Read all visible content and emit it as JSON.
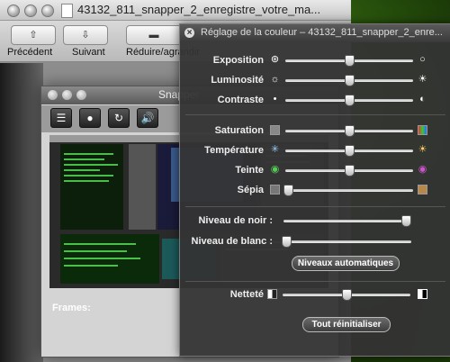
{
  "preview": {
    "title": "43132_811_snapper_2_enregistre_votre_ma...",
    "toolbar": {
      "prev_label": "Précédent",
      "next_label": "Suivant",
      "zoom_label": "Réduire/agrandir"
    }
  },
  "snapper": {
    "title": "Snapper",
    "frames_label": "Frames:"
  },
  "hud": {
    "title": "Réglage de la couleur – 43132_811_snapper_2_enre...",
    "sliders": [
      {
        "label": "Exposition",
        "value": 0.5
      },
      {
        "label": "Luminosité",
        "value": 0.5
      },
      {
        "label": "Contraste",
        "value": 0.5
      },
      {
        "label": "Saturation",
        "value": 0.5
      },
      {
        "label": "Température",
        "value": 0.5
      },
      {
        "label": "Teinte",
        "value": 0.5
      },
      {
        "label": "Sépia",
        "value": 0.0
      }
    ],
    "levels": [
      {
        "label": "Niveau de noir :",
        "value": 1.0
      },
      {
        "label": "Niveau de blanc :",
        "value": 0.0
      }
    ],
    "auto_levels_label": "Niveaux automatiques",
    "sharpness": {
      "label": "Netteté",
      "value": 0.5
    },
    "reset_label": "Tout réinitialiser"
  }
}
